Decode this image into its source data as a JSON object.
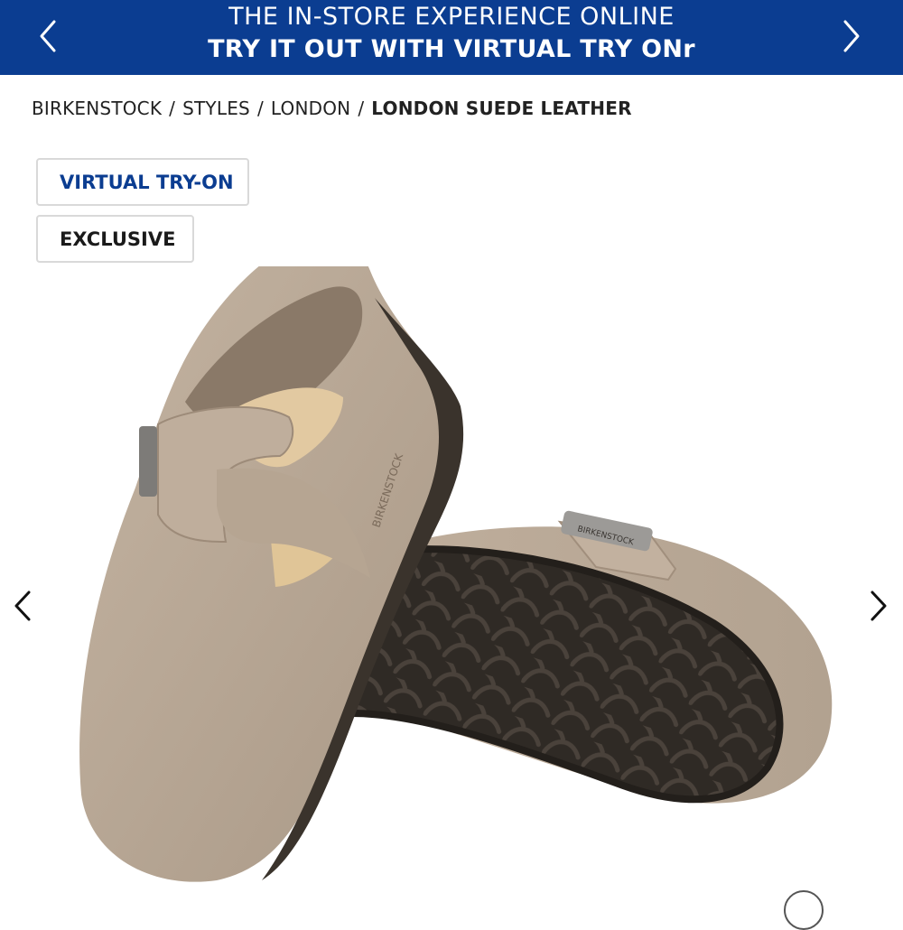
{
  "promo_banner": {
    "line1": "THE IN-STORE EXPERIENCE ONLINE",
    "line2": "TRY IT OUT WITH VIRTUAL TRY ONr",
    "background_color": "#0b3d91",
    "prev_icon": "chevron-left-icon",
    "next_icon": "chevron-right-icon"
  },
  "breadcrumb": {
    "items": [
      "BIRKENSTOCK",
      "STYLES",
      "LONDON"
    ],
    "current": "LONDON SUEDE LEATHER",
    "separator": "/"
  },
  "badges": {
    "virtual_try_on": "VIRTUAL TRY-ON",
    "exclusive": "EXCLUSIVE"
  },
  "product_image": {
    "brand_text": "BIRKENSTOCK",
    "suede_color": "#b9a896",
    "sole_color": "#2f2a25"
  },
  "gallery": {
    "prev_icon": "chevron-left-icon",
    "next_icon": "chevron-right-icon"
  }
}
